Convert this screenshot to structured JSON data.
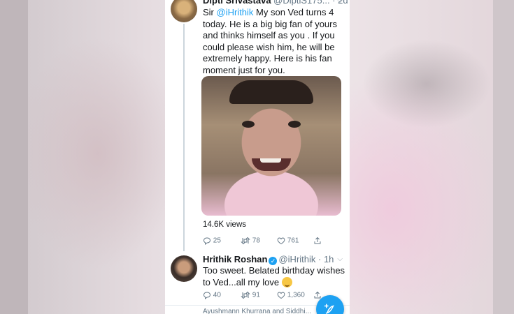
{
  "tweet1": {
    "name": "Dipti Srivastava",
    "handle": "@DiptiS175...",
    "time": "· 2d",
    "text_prefix": "Sir ",
    "mention": "@iHrithik",
    "text_rest": " My son Ved turns 4 today. He is a big big fan of yours and thinks himself as you . If you could please wish him, he will be extremely happy. Here is his fan moment just for you.",
    "views": "14.6K views",
    "replies": "25",
    "retweets": "78",
    "likes": "761"
  },
  "tweet2": {
    "name": "Hrithik Roshan",
    "handle": "@iHrithik",
    "time": "· 1h",
    "text": "Too sweet. Belated birthday wishes to Ved...all my love",
    "replies": "40",
    "retweets": "91",
    "likes": "1,360"
  },
  "footer": {
    "text": "Ayushmann Khurrana and Siddhi..."
  },
  "icons": {
    "reply": "reply-icon",
    "retweet": "retweet-icon",
    "like": "like-icon",
    "share": "share-icon",
    "compose": "compose-icon",
    "verified": "verified-icon",
    "emoji": "hugging-face-emoji"
  },
  "colors": {
    "accent": "#1da1f2",
    "text": "#14171a",
    "muted": "#657786"
  }
}
